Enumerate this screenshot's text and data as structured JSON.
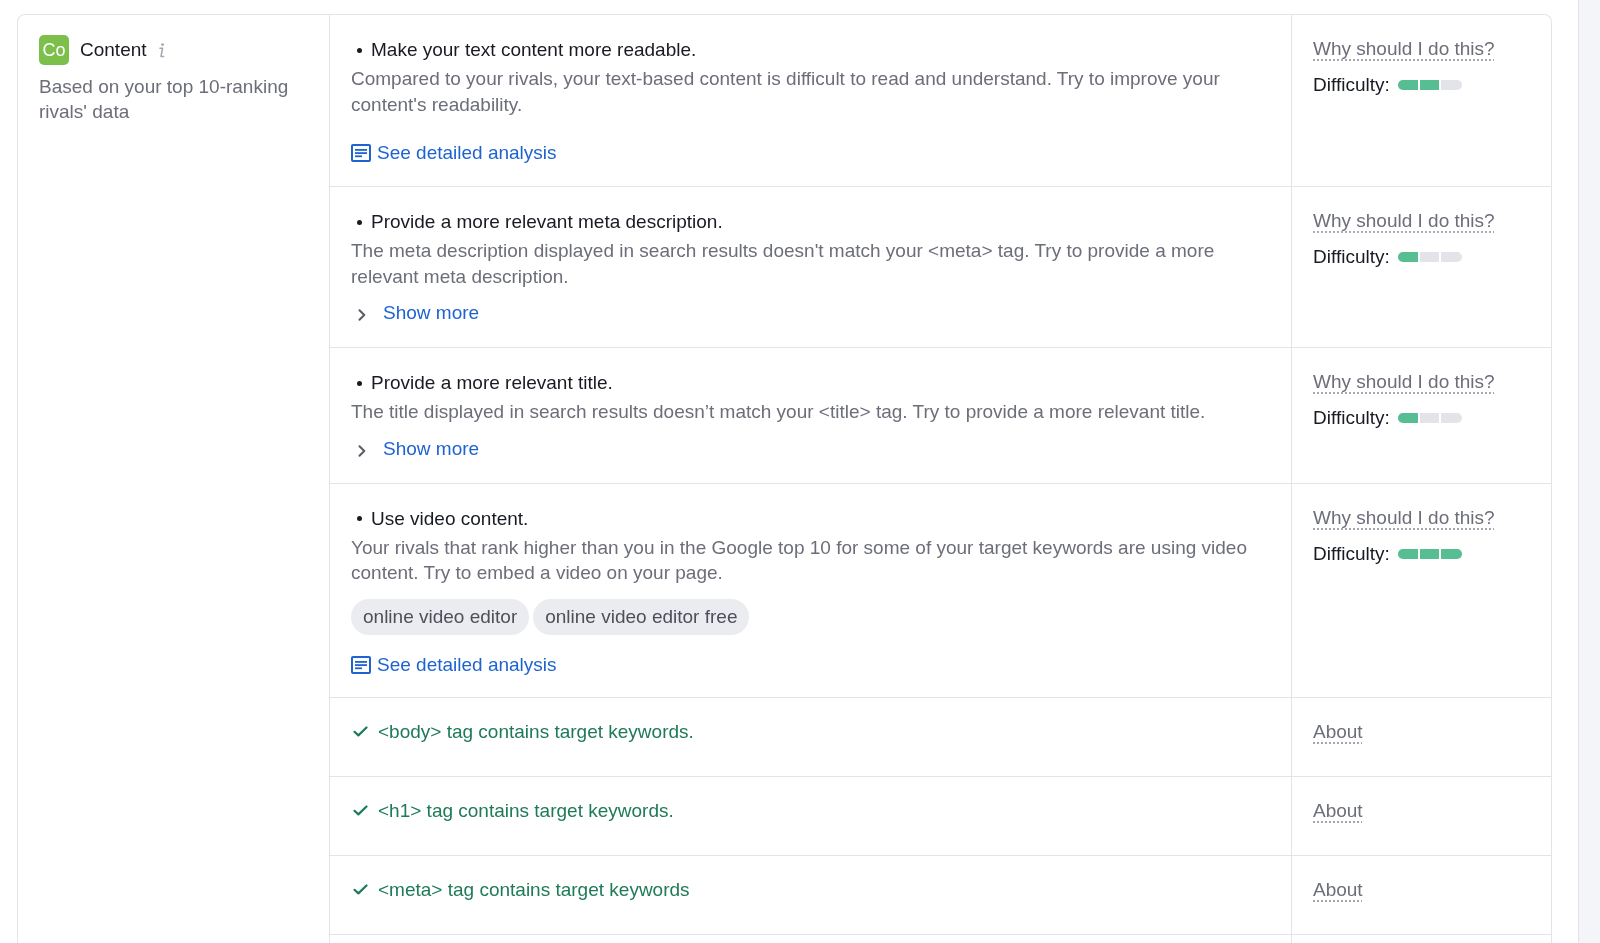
{
  "category": {
    "badge": "Co",
    "title": "Content",
    "subtitle": "Based on your top 10-ranking rivals' data"
  },
  "items": [
    {
      "kind": "recommendation",
      "title": "Make your text content more readable.",
      "description": "Compared to your rivals, your text-based content is difficult to read and understand. Try to improve your content's readability.",
      "action": {
        "kind": "analysis",
        "label": "See detailed analysis"
      },
      "help_link": "Why should I do this?",
      "difficulty": {
        "label": "Difficulty:",
        "level": 0.67
      }
    },
    {
      "kind": "recommendation",
      "title": "Provide a more relevant meta description.",
      "description": "The meta description displayed in search results doesn't match your <meta> tag. Try to provide a more relevant meta description.",
      "action": {
        "kind": "expand",
        "label": "Show more",
        "expanded": false
      },
      "help_link": "Why should I do this?",
      "difficulty": {
        "label": "Difficulty:",
        "level": 0.33
      }
    },
    {
      "kind": "recommendation",
      "title": "Provide a more relevant title.",
      "description": "The title displayed in search results doesn’t match your <title> tag. Try to provide a more relevant title.",
      "action": {
        "kind": "expand",
        "label": "Show more",
        "expanded": false
      },
      "help_link": "Why should I do this?",
      "difficulty": {
        "label": "Difficulty:",
        "level": 0.33
      }
    },
    {
      "kind": "recommendation",
      "title": "Use video content.",
      "description": "Your rivals that rank higher than you in the Google top 10 for some of your target keywords are using video content. Try to embed a video on your page.",
      "tags": [
        "online video editor",
        "online video editor free"
      ],
      "action": {
        "kind": "analysis",
        "label": "See detailed analysis"
      },
      "help_link": "Why should I do this?",
      "difficulty": {
        "label": "Difficulty:",
        "level": 1
      }
    },
    {
      "kind": "passed",
      "title": "<body> tag contains target keywords.",
      "help_link": "About"
    },
    {
      "kind": "passed",
      "title": "<h1> tag contains target keywords.",
      "help_link": "About"
    },
    {
      "kind": "passed",
      "title": "<meta> tag contains target keywords",
      "help_link": "About"
    }
  ]
}
